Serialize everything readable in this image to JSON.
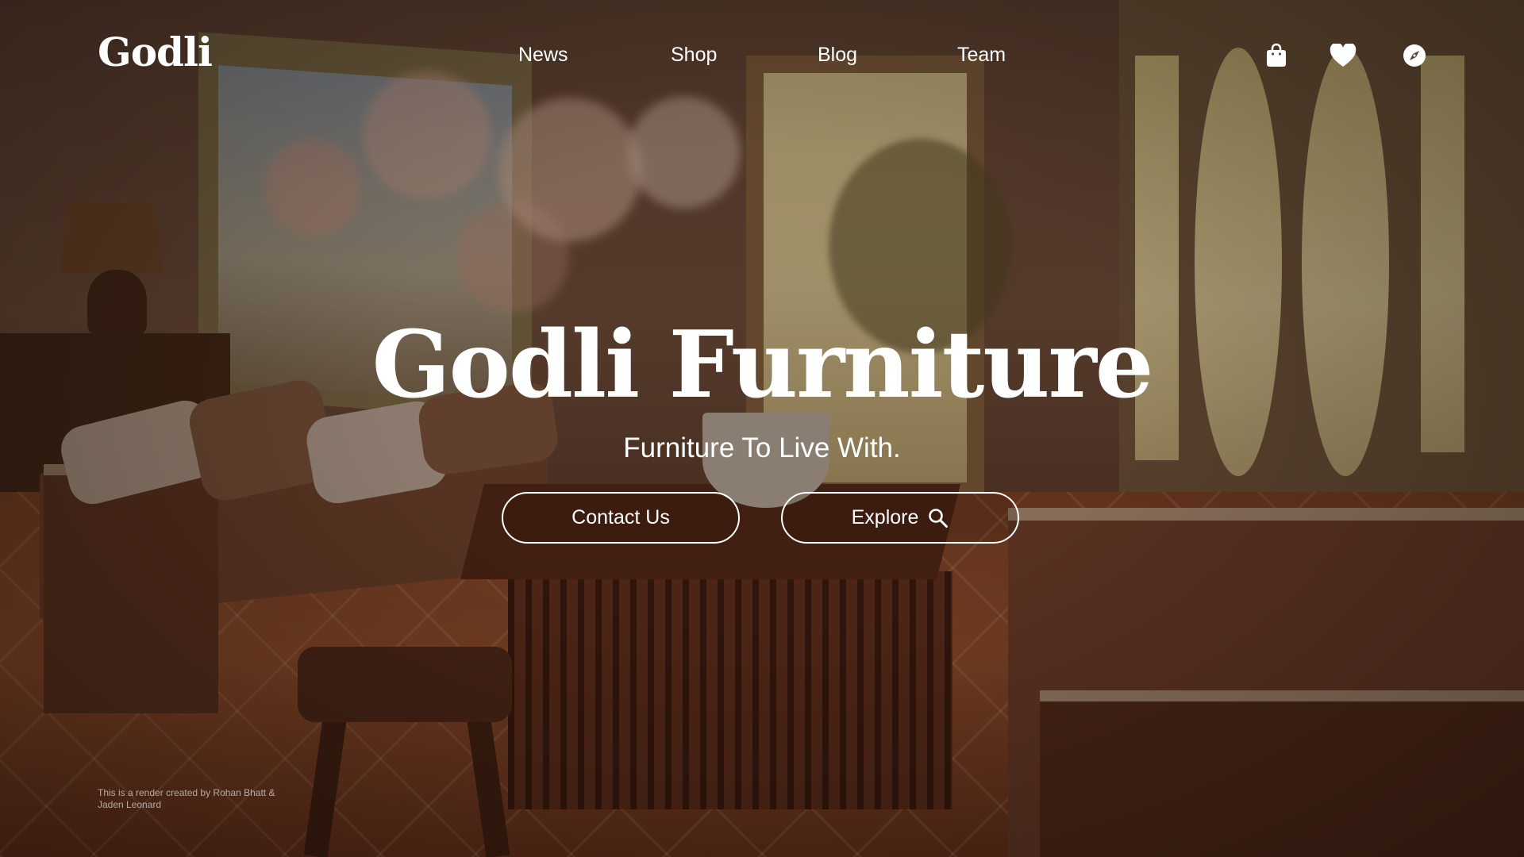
{
  "brand": {
    "logo_text": "Godli"
  },
  "nav": {
    "links": [
      {
        "label": "News"
      },
      {
        "label": "Shop"
      },
      {
        "label": "Blog"
      },
      {
        "label": "Team"
      }
    ],
    "icons": [
      "shopping-bag-icon",
      "heart-icon",
      "compass-icon"
    ]
  },
  "hero": {
    "title": "Godli Furniture",
    "subtitle": "Furniture To Live With.",
    "buttons": {
      "contact_label": "Contact Us",
      "explore_label": "Explore",
      "explore_icon": "search-icon"
    }
  },
  "footer": {
    "credit": "This is a render created by Rohan Bhatt & Jaden Leonard"
  },
  "colors": {
    "text": "#ffffff",
    "overlay": "#190c06"
  }
}
